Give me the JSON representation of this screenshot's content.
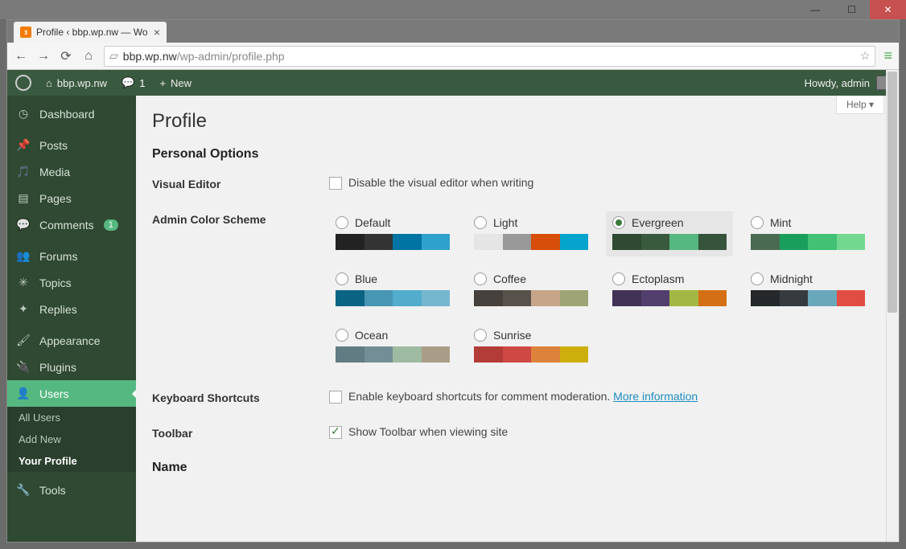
{
  "window": {
    "tab_title": "Profile ‹ bbp.wp.nw — Wo"
  },
  "browser": {
    "url_host": "bbp.wp.nw",
    "url_path": "/wp-admin/profile.php"
  },
  "adminbar": {
    "site": "bbp.wp.nw",
    "comments_count": "1",
    "new_label": "New",
    "howdy": "Howdy, admin"
  },
  "sidebar": {
    "items": [
      {
        "label": "Dashboard",
        "icon": "dashboard-icon"
      },
      {
        "label": "Posts",
        "icon": "pin-icon"
      },
      {
        "label": "Media",
        "icon": "media-icon"
      },
      {
        "label": "Pages",
        "icon": "page-icon"
      },
      {
        "label": "Comments",
        "icon": "comment-icon",
        "badge": "1"
      },
      {
        "label": "Forums",
        "icon": "forums-icon"
      },
      {
        "label": "Topics",
        "icon": "topics-icon"
      },
      {
        "label": "Replies",
        "icon": "replies-icon"
      },
      {
        "label": "Appearance",
        "icon": "appearance-icon"
      },
      {
        "label": "Plugins",
        "icon": "plugins-icon"
      },
      {
        "label": "Users",
        "icon": "users-icon",
        "current": true
      },
      {
        "label": "Tools",
        "icon": "tools-icon"
      }
    ],
    "submenu": [
      {
        "label": "All Users"
      },
      {
        "label": "Add New"
      },
      {
        "label": "Your Profile",
        "active": true
      }
    ]
  },
  "page": {
    "help": "Help",
    "title": "Profile",
    "section_personal": "Personal Options",
    "section_name": "Name",
    "visual_editor_label": "Visual Editor",
    "visual_editor_checkbox": "Disable the visual editor when writing",
    "color_label": "Admin Color Scheme",
    "keyboard_label": "Keyboard Shortcuts",
    "keyboard_checkbox": "Enable keyboard shortcuts for comment moderation. ",
    "keyboard_link": "More information",
    "toolbar_label": "Toolbar",
    "toolbar_checkbox": "Show Toolbar when viewing site",
    "schemes": [
      {
        "name": "Default",
        "colors": [
          "#222222",
          "#333333",
          "#0074a2",
          "#2ea2cc"
        ]
      },
      {
        "name": "Light",
        "colors": [
          "#e5e5e5",
          "#999999",
          "#d64e07",
          "#04a4cc"
        ]
      },
      {
        "name": "Evergreen",
        "colors": [
          "#2f4932",
          "#395a3d",
          "#56b881",
          "#36533c"
        ],
        "selected": true
      },
      {
        "name": "Mint",
        "colors": [
          "#4a6b52",
          "#1a9e5c",
          "#40c173",
          "#72d88f"
        ]
      },
      {
        "name": "Blue",
        "colors": [
          "#096484",
          "#4796b3",
          "#52accc",
          "#74b6ce"
        ]
      },
      {
        "name": "Coffee",
        "colors": [
          "#46403c",
          "#59524c",
          "#c7a589",
          "#9ea476"
        ]
      },
      {
        "name": "Ectoplasm",
        "colors": [
          "#413256",
          "#523f6d",
          "#a3b745",
          "#d46f15"
        ]
      },
      {
        "name": "Midnight",
        "colors": [
          "#25282b",
          "#363b3f",
          "#69a8bb",
          "#e14d43"
        ]
      },
      {
        "name": "Ocean",
        "colors": [
          "#627c83",
          "#738e96",
          "#9ebaa0",
          "#aa9d88"
        ]
      },
      {
        "name": "Sunrise",
        "colors": [
          "#b43c38",
          "#cf4944",
          "#dd823b",
          "#ccaf0b"
        ]
      }
    ]
  }
}
